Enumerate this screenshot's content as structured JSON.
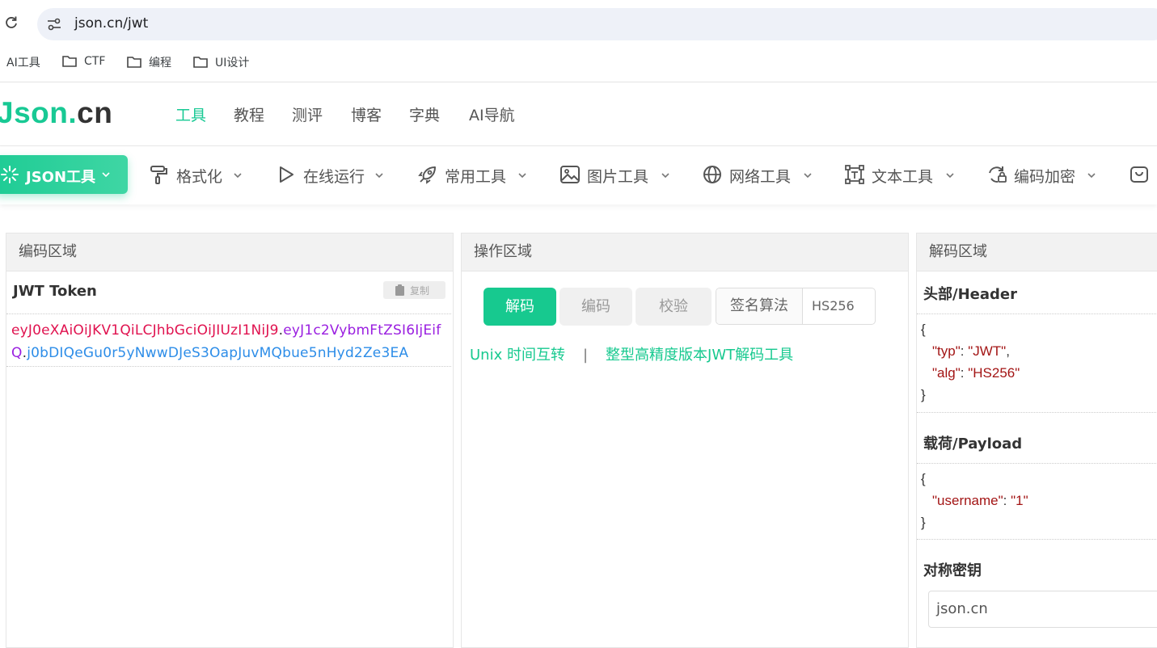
{
  "browser": {
    "url": "json.cn/jwt",
    "bookmarks": [
      {
        "label": "AI工具",
        "folder": false
      },
      {
        "label": "CTF",
        "folder": true
      },
      {
        "label": "编程",
        "folder": true
      },
      {
        "label": "UI设计",
        "folder": true
      }
    ]
  },
  "site": {
    "logo_part1": "Json.",
    "logo_part2": "cn",
    "nav": [
      "工具",
      "教程",
      "测评",
      "博客",
      "字典",
      "AI导航"
    ],
    "active_nav": "工具"
  },
  "toolnav": {
    "active": {
      "label": "JSON工具",
      "icon": "sparkle-icon"
    },
    "items": [
      {
        "label": "格式化",
        "icon": "paint-roller-icon"
      },
      {
        "label": "在线运行",
        "icon": "play-icon"
      },
      {
        "label": "常用工具",
        "icon": "rocket-icon"
      },
      {
        "label": "图片工具",
        "icon": "image-icon"
      },
      {
        "label": "网络工具",
        "icon": "globe-icon"
      },
      {
        "label": "文本工具",
        "icon": "text-frame-icon"
      },
      {
        "label": "编码加密",
        "icon": "refresh-lock-icon"
      }
    ]
  },
  "encode_panel": {
    "title": "编码区域",
    "token_label": "JWT Token",
    "copy_label": "复制",
    "token_header": "eyJ0eXAiOiJKV1QiLCJhbGciOiJIUzI1NiJ9",
    "token_payload": "eyJ1c2VybmFtZSI6IjEifQ",
    "token_signature": "j0bDIQeGu0r5yNwwDJeS3OapJuvMQbue5nHyd2Ze3EA",
    "dot": "."
  },
  "op_panel": {
    "title": "操作区域",
    "decode": "解码",
    "encode": "编码",
    "verify": "校验",
    "alg_label": "签名算法",
    "alg_value": "HS256",
    "link1": "Unix 时间互转",
    "sep": "|",
    "link2": "整型高精度版本JWT解码工具"
  },
  "decode_panel": {
    "title": "解码区域",
    "header_label": "头部/Header",
    "header_json": {
      "typ_key": "\"typ\"",
      "typ_val": "\"JWT\"",
      "alg_key": "\"alg\"",
      "alg_val": "\"HS256\""
    },
    "payload_label": "载荷/Payload",
    "payload_json": {
      "username_key": "\"username\"",
      "username_val": "\"1\""
    },
    "secret_label": "对称密钥",
    "secret_value": "json.cn",
    "brace_open": "{",
    "brace_close": "}",
    "colon": ": ",
    "comma": ","
  },
  "colors": {
    "accent": "#18c994",
    "token_header": "#e0124f",
    "token_payload": "#9a1fe0",
    "token_signature": "#2d8de8",
    "json_key": "#a31515"
  }
}
